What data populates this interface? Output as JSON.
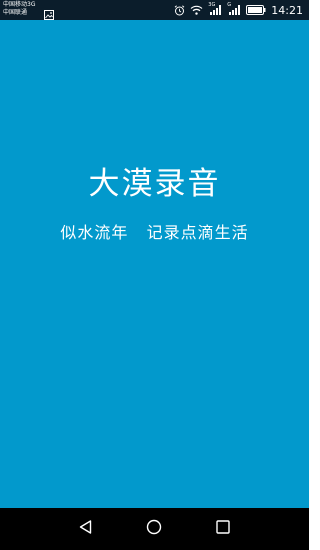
{
  "status_bar": {
    "carrier_1": "中国移动3G",
    "carrier_2": "中国联通",
    "network_1": "3G",
    "network_2": "G",
    "time": "14:21",
    "icons": [
      "gallery-icon",
      "alarm-icon",
      "wifi-icon",
      "signal-icon",
      "battery-icon"
    ]
  },
  "splash": {
    "title": "大漠录音",
    "subtitle": "似水流年   记录点滴生活",
    "background_color": "#0299cc"
  },
  "nav_bar": {
    "buttons": [
      "back-icon",
      "home-icon",
      "recents-icon"
    ]
  }
}
